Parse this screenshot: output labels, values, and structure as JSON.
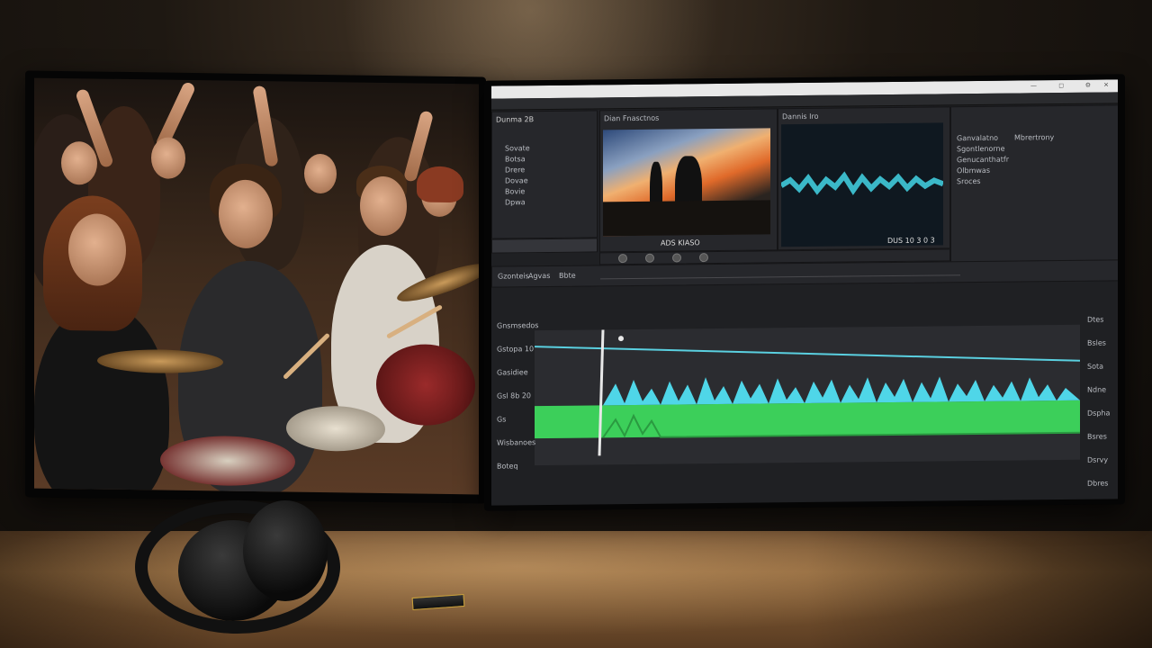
{
  "scene": {
    "description_tags": [
      "desk",
      "two-monitors",
      "headphones",
      "memory-card"
    ]
  },
  "editor": {
    "title_text": "",
    "panels": {
      "media": {
        "title": "Dunma 2B",
        "rows": [
          "Sovate",
          "Botsa",
          "Drere",
          "Dovae",
          "Bovie",
          "Dpwa"
        ]
      },
      "viewer": {
        "title": "Dian Fnasctnos",
        "timecode": "ADS KIASO"
      },
      "scope": {
        "title": "Dannis Iro",
        "timecode": "DUS 10 3 0 3"
      },
      "inspector": {
        "items": [
          "Ganvalatno",
          "Sgontlenorne",
          "Genucanthatfr",
          "Olbmwas",
          "Sroces"
        ],
        "extra": "Mbrertrony"
      },
      "timeline": {
        "track_labels": [
          "Gnsmsedos",
          "Gstopa 10",
          "Gasidiee",
          "Gsl 8b 20",
          "Gs",
          "Wisbanoes",
          "Boteq"
        ],
        "right_labels": [
          "Dtes",
          "Bsles",
          "Sota",
          "Ndne",
          "Dspha",
          "Bsres",
          "Dsrvy",
          "Dbres"
        ],
        "transport_labels": [
          "Gzonteis",
          "Agvas",
          "Bbte"
        ]
      }
    },
    "colors": {
      "waveform_cyan": "#4fd6e8",
      "waveform_green": "#3ccf5a",
      "playhead": "#e8e8e8"
    }
  }
}
